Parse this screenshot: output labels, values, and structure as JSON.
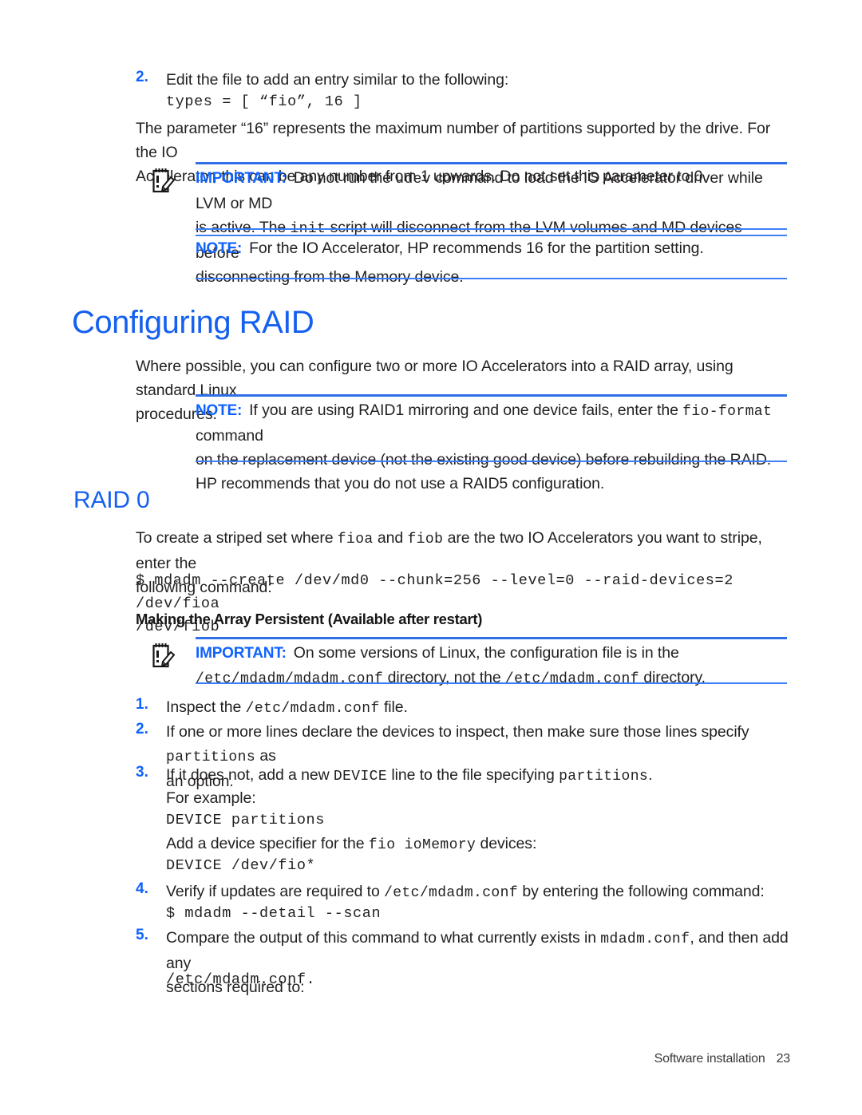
{
  "page": {
    "footer_section": "Software installation",
    "footer_page_number": "23",
    "accent_blue": "#0f62fe",
    "heading_blue": "#1560f0",
    "rule_blue": "#3d7ff5",
    "body_color": "#221f1f"
  },
  "intro": {
    "step2_num": "2.",
    "step2_text": "Edit the file to add an entry similar to the following:",
    "step2_code": "types = [ “fio”, 16 ]",
    "paragraph_line1": "The parameter “16” represents the maximum number of partitions supported by the drive. For the IO",
    "paragraph_line2": "Accelerator, this can be any number from 1 upwards. Do not set this parameter to 0."
  },
  "important_udev": {
    "icon": "note-pencil-icon",
    "label": "IMPORTANT:",
    "line1_a": "Do not run the ",
    "line1_code": "udev",
    "line1_b": " command to load the IO Accelerator driver while LVM or MD",
    "line2_a": "is active. The ",
    "line2_code": "init",
    "line2_b": " script will disconnect from the LVM volumes and MD devices before",
    "line3": "disconnecting from the Memory device."
  },
  "note_partition": {
    "label": "NOTE:",
    "text": "For the IO Accelerator, HP recommends 16 for the partition setting."
  },
  "configuring_raid": {
    "heading": "Configuring RAID",
    "paragraph_line1": "Where possible, you can configure two or more IO Accelerators into a RAID array, using standard Linux",
    "paragraph_line2": "procedures."
  },
  "note_raid1": {
    "label": "NOTE:",
    "line1_a": "If you are using RAID1 mirroring and one device fails, enter the ",
    "line1_code": "fio-format",
    "line1_b": " command",
    "line2": "on the replacement device (not the existing good device) before rebuilding the RAID.",
    "line3": "HP recommends that you do not use a RAID5 configuration."
  },
  "raid0": {
    "heading": "RAID 0",
    "intro_a": "To create a striped set where ",
    "intro_code1": "fioa",
    "intro_b": " and ",
    "intro_code2": "fiob",
    "intro_c": " are the two IO Accelerators you want to stripe, enter the",
    "intro_line2": "following command:",
    "command_line1": "$ mdadm --create /dev/md0 --chunk=256 --level=0 --raid-devices=2 /dev/fioa",
    "command_line2": "/dev/fiob"
  },
  "persistent": {
    "subheading": "Making the Array Persistent (Available after restart)",
    "important": {
      "icon": "note-pencil-icon",
      "label": "IMPORTANT:",
      "line1": "On some versions of Linux, the configuration file is in the",
      "line2_code1": "/etc/mdadm/mdadm.conf",
      "line2_a": " directory, not the ",
      "line2_code2": "/etc/mdadm.conf",
      "line2_b": " directory."
    },
    "steps": [
      {
        "num": "1.",
        "text_a": "Inspect the ",
        "code": "/etc/mdadm.conf",
        "text_b": " file."
      },
      {
        "num": "2.",
        "text_a": "If one or more lines declare the devices to inspect, then make sure those lines specify ",
        "code": "partitions",
        "text_b": " as",
        "line2": "an option."
      },
      {
        "num": "3.",
        "text_a": "If it does not, add a new ",
        "code": "DEVICE",
        "text_b": " line to the file specifying ",
        "code2": "partitions",
        "text_c": ".",
        "line2": "For example:",
        "example_code1": "DEVICE partitions",
        "example_text_a": "Add a device specifier for the ",
        "example_code_inline": "fio ioMemory",
        "example_text_b": " devices:",
        "example_code2": "DEVICE /dev/fio*"
      },
      {
        "num": "4.",
        "text_a": "Verify if updates are required to ",
        "code": "/etc/mdadm.conf",
        "text_b": " by entering the following command:",
        "command": "$ mdadm --detail --scan"
      },
      {
        "num": "5.",
        "text_a": "Compare the output of this command to what currently exists in ",
        "code": "mdadm.conf",
        "text_b": ", and then add any",
        "line2": "sections required to:",
        "trailing_code": "/etc/mdadm.conf."
      }
    ]
  }
}
